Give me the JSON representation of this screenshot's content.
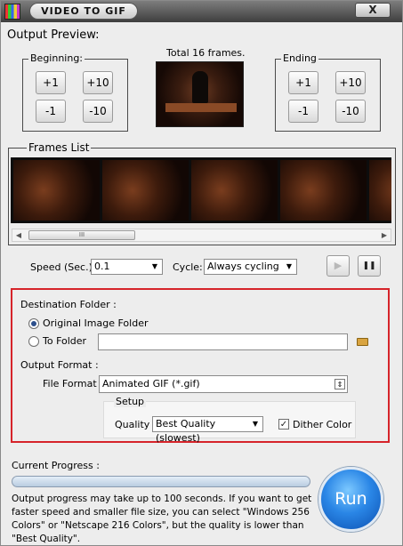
{
  "titlebar": {
    "title": "VIDEO TO GIF",
    "close_label": "X"
  },
  "output_preview": {
    "label": "Output Preview:",
    "total_frames": "Total 16 frames.",
    "beginning": {
      "legend": "Beginning:",
      "buttons": [
        "+1",
        "+10",
        "-1",
        "-10"
      ]
    },
    "ending": {
      "legend": "Ending",
      "buttons": [
        "+1",
        "+10",
        "-1",
        "-10"
      ]
    }
  },
  "frames_list": {
    "legend": "Frames List",
    "scroll_thumb_glyph": "III"
  },
  "playback": {
    "speed_label": "Speed (Sec.):",
    "speed_value": "0.1",
    "cycle_label": "Cycle:",
    "cycle_value": "Always cycling",
    "play_glyph": "▶",
    "pause_glyph": "❚❚"
  },
  "destination": {
    "label": "Destination Folder :",
    "option_original": "Original Image Folder",
    "option_to_folder": "To Folder",
    "to_folder_value": "",
    "selected": "Original Image Folder"
  },
  "output_format": {
    "label": "Output Format :",
    "file_format_label": "File Format",
    "file_format_value": "Animated GIF (*.gif)",
    "setup_label": "Setup",
    "quality_label": "Quality :",
    "quality_value": "Best Quality (slowest)",
    "dither_label": "Dither Color",
    "dither_checked": true
  },
  "progress": {
    "label": "Current Progress :",
    "value": 0,
    "note": "Output progress may take up to 100 seconds. If you want to get faster speed and smaller file size, you can select \"Windows 256 Colors\" or \"Netscape 216 Colors\", but the quality is lower than \"Best Quality\"."
  },
  "run_button": {
    "label": "Run"
  },
  "colors": {
    "highlight_border": "#d6242a",
    "run_button": "#2a86e6"
  }
}
